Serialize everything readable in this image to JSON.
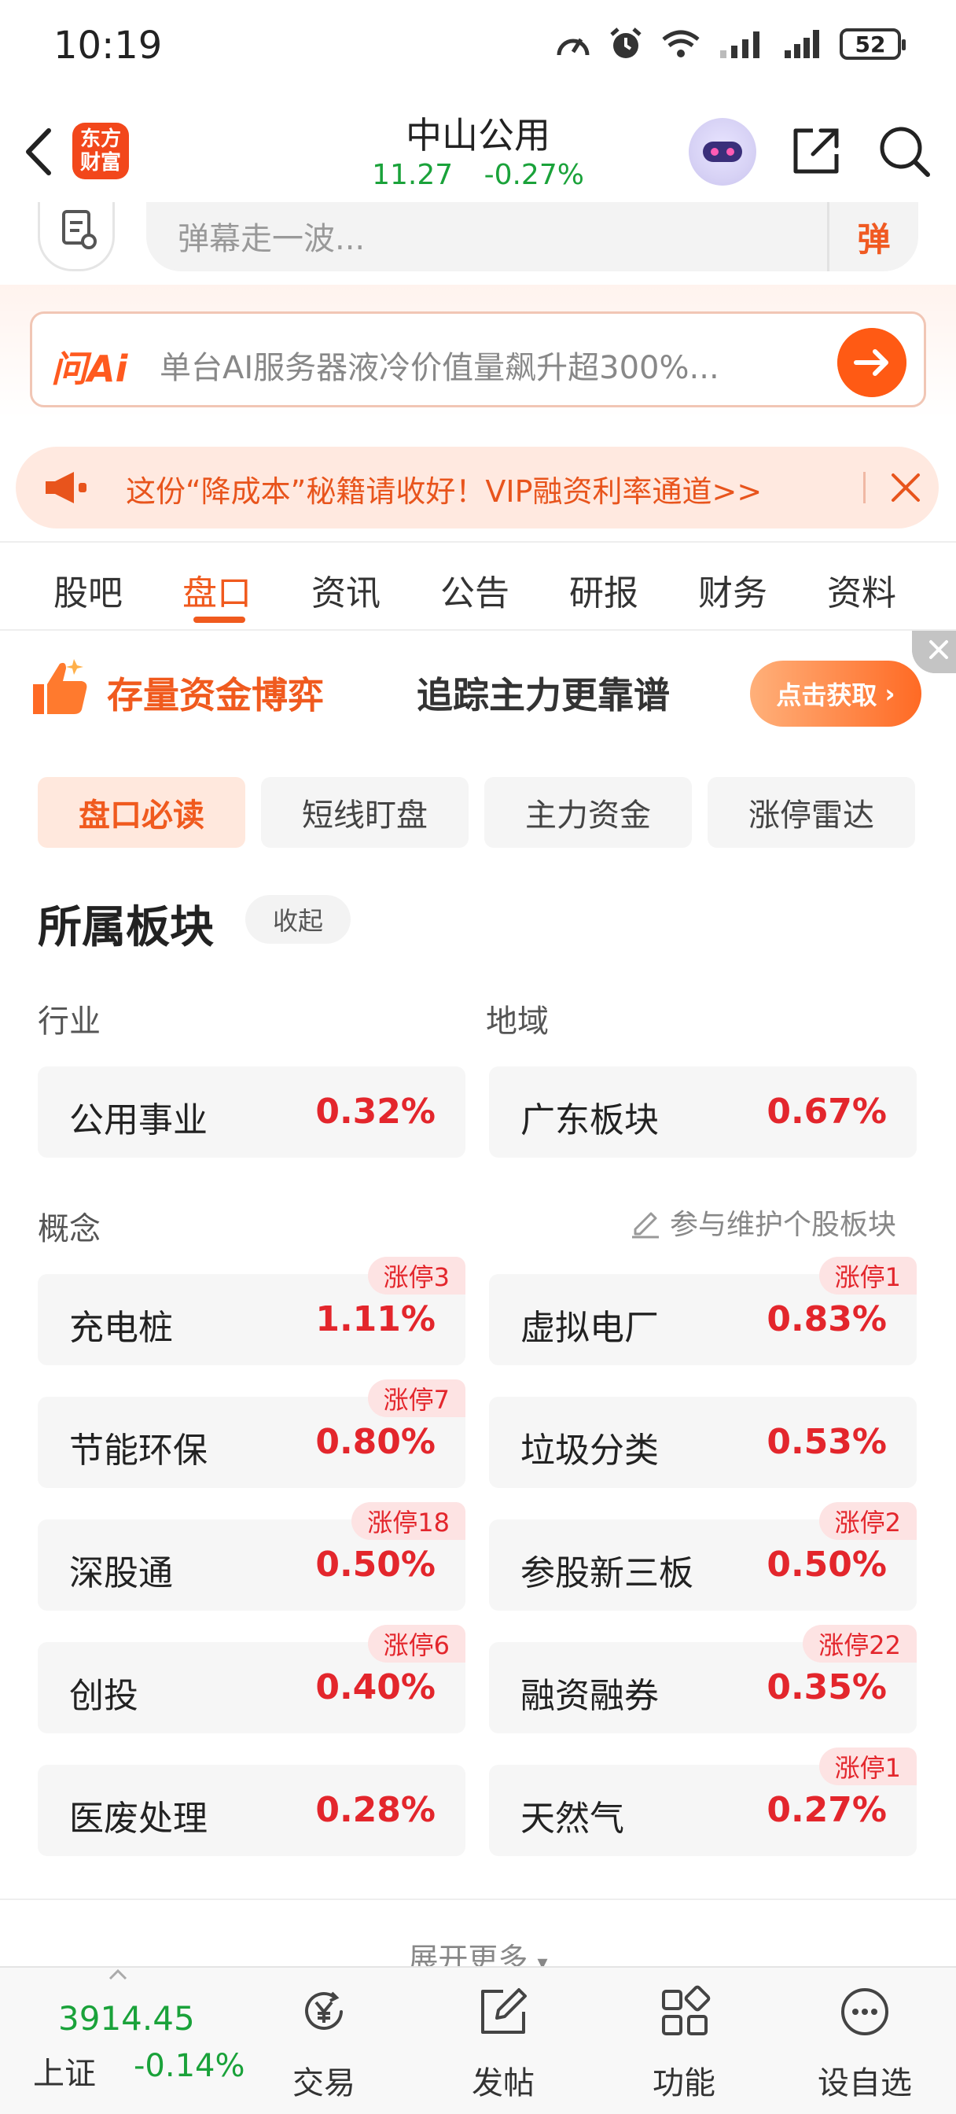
{
  "status_bar": {
    "time": "10:19",
    "battery": "52"
  },
  "header": {
    "logo_text": "东方财富",
    "stock_name": "中山公用",
    "price": "11.27",
    "change": "-0.27%"
  },
  "danmu": {
    "placeholder": "弹幕走一波...",
    "send_label": "弹"
  },
  "ai_banner": {
    "logo": "问Ai",
    "text": "单台AI服务器液冷价值量飙升超300%..."
  },
  "notice": {
    "text": "这份“降成本”秘籍请收好！VIP融资利率通道>>"
  },
  "tabs": [
    "股吧",
    "盘口",
    "资讯",
    "公告",
    "研报",
    "财务",
    "资料"
  ],
  "active_tab": "盘口",
  "promo": {
    "title": "存量资金博弈",
    "subtitle": "追踪主力更靠谱",
    "button": "点击获取"
  },
  "subtabs": [
    "盘口必读",
    "短线盯盘",
    "主力资金",
    "涨停雷达"
  ],
  "section": {
    "title": "所属板块",
    "collapse_label": "收起",
    "industry_label": "行业",
    "region_label": "地域",
    "concept_label": "概念",
    "maintain_label": "参与维护个股板块",
    "industry": {
      "name": "公用事业",
      "pct": "0.32%"
    },
    "region": {
      "name": "广东板块",
      "pct": "0.67%"
    },
    "concepts": [
      {
        "name": "充电桩",
        "pct": "1.11%",
        "badge": "涨停3"
      },
      {
        "name": "虚拟电厂",
        "pct": "0.83%",
        "badge": "涨停1"
      },
      {
        "name": "节能环保",
        "pct": "0.80%",
        "badge": "涨停7"
      },
      {
        "name": "垃圾分类",
        "pct": "0.53%",
        "badge": ""
      },
      {
        "name": "深股通",
        "pct": "0.50%",
        "badge": "涨停18"
      },
      {
        "name": "参股新三板",
        "pct": "0.50%",
        "badge": "涨停2"
      },
      {
        "name": "创投",
        "pct": "0.40%",
        "badge": "涨停6"
      },
      {
        "name": "融资融券",
        "pct": "0.35%",
        "badge": "涨停22"
      },
      {
        "name": "医废处理",
        "pct": "0.28%",
        "badge": ""
      },
      {
        "name": "天然气",
        "pct": "0.27%",
        "badge": "涨停1"
      }
    ],
    "expand_label": "展开更多"
  },
  "bottom_bar": {
    "index_value": "3914.45",
    "index_name": "上证",
    "index_change": "-0.14%",
    "nav": [
      "交易",
      "发帖",
      "功能",
      "设自选"
    ]
  },
  "colors": {
    "accent": "#f05a1e",
    "up": "#e3262c",
    "down": "#1aa23a"
  }
}
